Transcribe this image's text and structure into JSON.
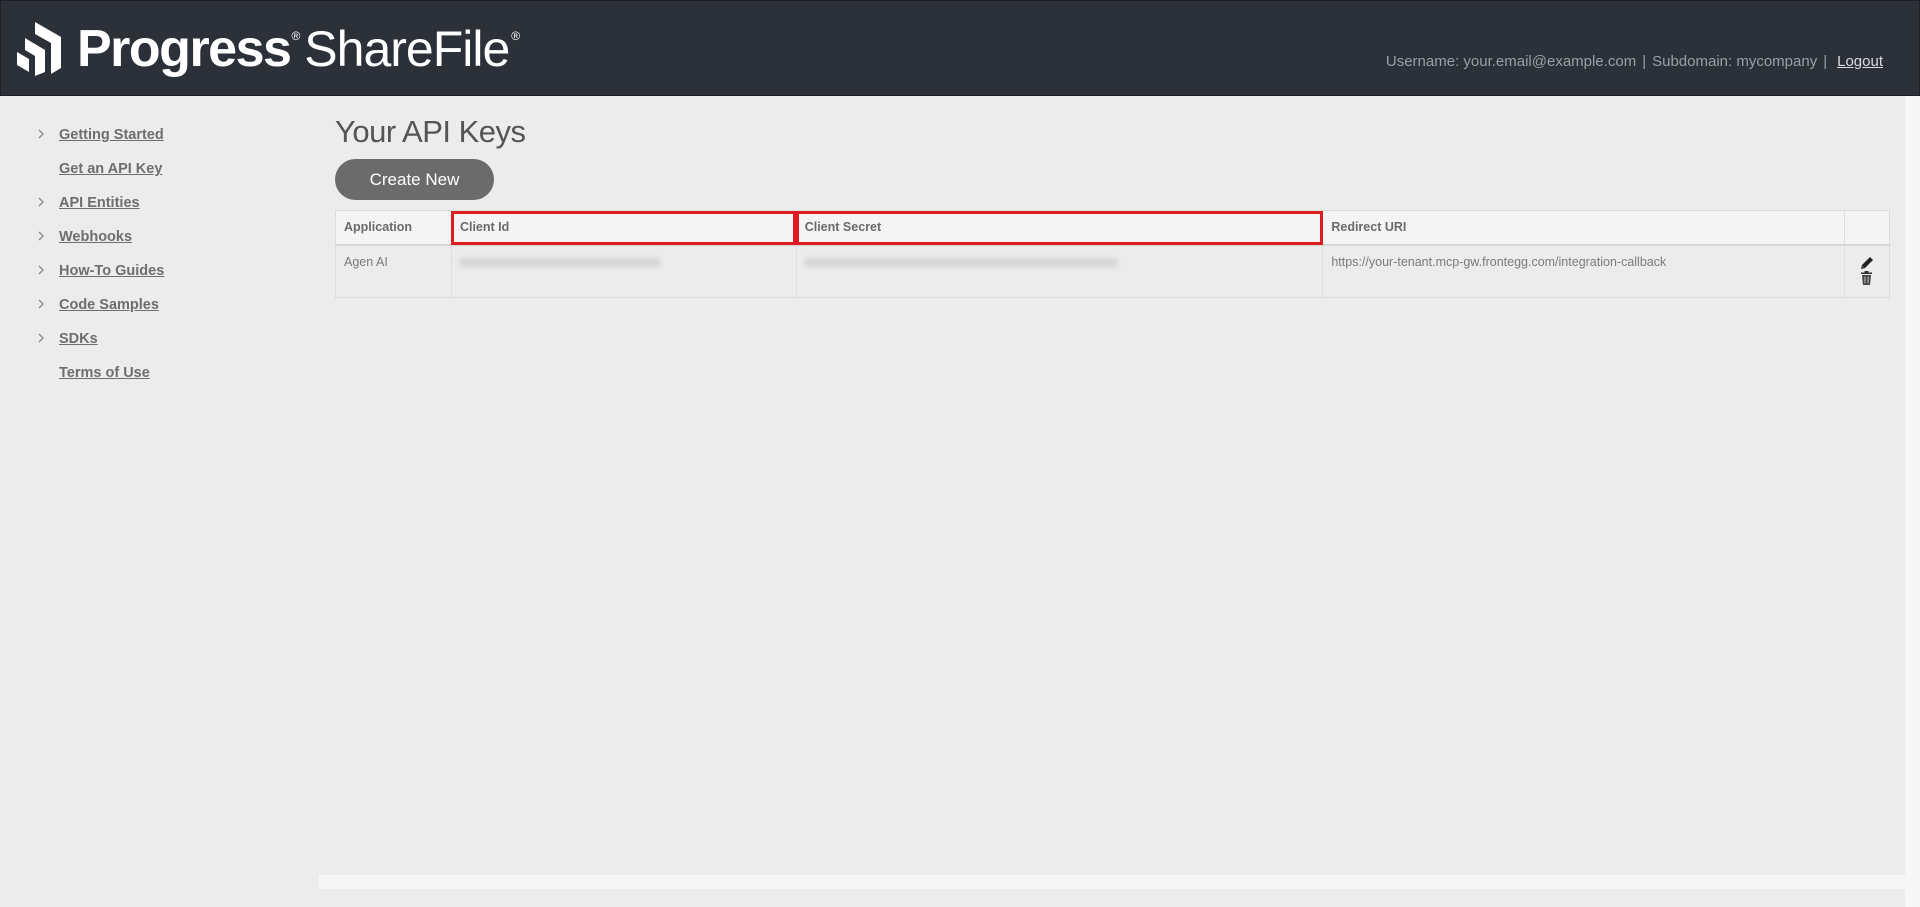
{
  "header": {
    "brand_primary": "Progress",
    "brand_secondary": "ShareFile",
    "registered_mark": "®",
    "username_text": "Username: your.email@example.com",
    "separator": "|",
    "subdomain_text": "Subdomain: mycompany",
    "logout_label": "Logout"
  },
  "sidebar": {
    "items": [
      {
        "label": "Getting Started",
        "expandable": true
      },
      {
        "label": "Get an API Key",
        "expandable": false
      },
      {
        "label": "API Entities",
        "expandable": true
      },
      {
        "label": "Webhooks",
        "expandable": true
      },
      {
        "label": "How-To Guides",
        "expandable": true
      },
      {
        "label": "Code Samples",
        "expandable": true
      },
      {
        "label": "SDKs",
        "expandable": true
      },
      {
        "label": "Terms of Use",
        "expandable": false
      }
    ]
  },
  "main": {
    "title": "Your API Keys",
    "create_button_label": "Create New",
    "table": {
      "columns": [
        "Application",
        "Client Id",
        "Client Secret",
        "Redirect URI",
        ""
      ],
      "rows": [
        {
          "application": "Agen AI",
          "client_id": "xxxxxxxxxxxxxxxxxxxxxxxxxxxxxxxx",
          "client_secret": "xxxxxxxxxxxxxxxxxxxxxxxxxxxxxxxxxxxxxxxxxxxxxxxxxx",
          "redirect_uri": "https://your-tenant.mcp-gw.frontegg.com/integration-callback"
        }
      ]
    }
  },
  "colors": {
    "header_bg": "#2c3038",
    "highlight": "#e11b22",
    "button_bg": "#6b6b6b",
    "page_bg": "#ececec"
  },
  "icons": {
    "logo": "progress-logo-icon",
    "chevron": "chevron-right-icon",
    "edit": "pencil-icon",
    "delete": "trash-icon"
  }
}
